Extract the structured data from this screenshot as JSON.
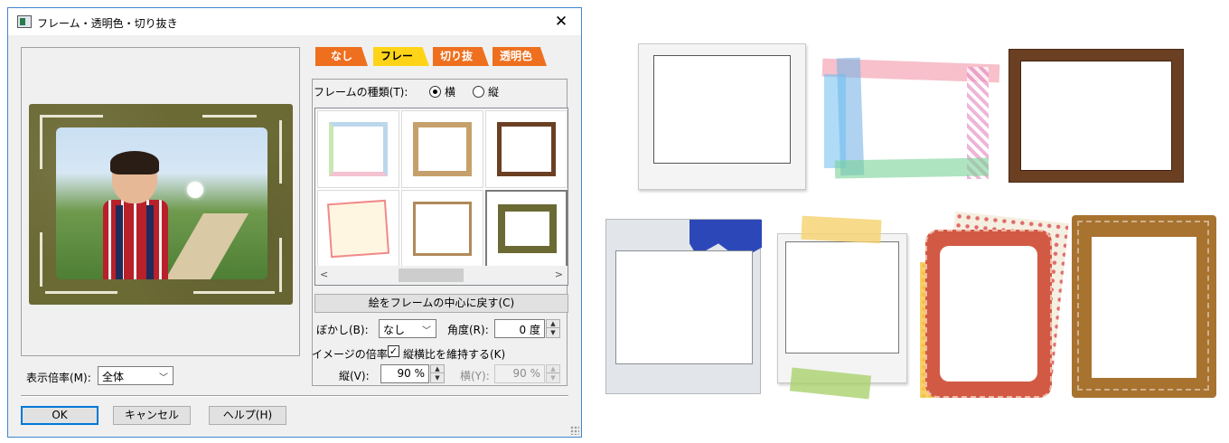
{
  "dialog": {
    "title": "フレーム・透明色・切り抜き",
    "close_glyph": "✕",
    "tabs": [
      {
        "label": "なし"
      },
      {
        "label": "フレーム"
      },
      {
        "label": "切り抜き"
      },
      {
        "label": "透明色"
      }
    ],
    "frame_type_label": "フレームの種類(T):",
    "orientation": {
      "horizontal": "横",
      "vertical": "縦",
      "selected": "horizontal"
    },
    "scroll_left": "<",
    "scroll_right": ">",
    "center_button": "絵をフレームの中心に戻す(C)",
    "blur_label": "ぼかし(B):",
    "blur_value": "なし",
    "angle_label": "角度(R):",
    "angle_value": "0 度",
    "image_scale_label": "イメージの倍率:",
    "keep_ratio_label": "縦横比を維持する(K)",
    "keep_ratio_checked": true,
    "vertical_label": "縦(V):",
    "vertical_value": "90 %",
    "horizontal_label": "横(Y):",
    "horizontal_value": "90 %",
    "zoom_label": "表示倍率(M):",
    "zoom_value": "全体",
    "ok": "OK",
    "cancel": "キャンセル",
    "help": "ヘルプ(H)"
  },
  "colors": {
    "tab_orange": "#ee6f1e",
    "tab_active": "#ffd418",
    "frame_olive": "#6b6a35",
    "frame_brown": "#6b3f22",
    "frame_red": "#d25a44",
    "frame_kraft": "#a8722f",
    "accent_blue": "#0078d7"
  }
}
